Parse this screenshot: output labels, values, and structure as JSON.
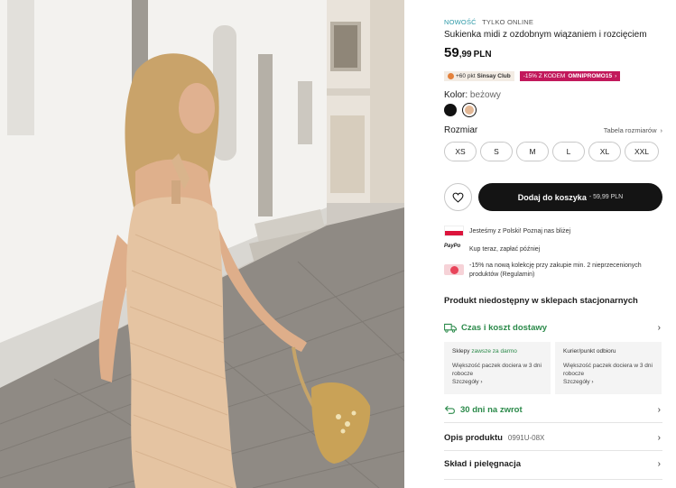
{
  "product": {
    "tag_new": "NOWOŚĆ",
    "tag_online": "TYLKO ONLINE",
    "title": "Sukienka midi z ozdobnym wiązaniem i rozcięciem",
    "price_main": "59",
    "price_cents": ",99",
    "currency": "PLN"
  },
  "promo": {
    "club_text": "+60 pkt",
    "club_name": "Sinsay Club",
    "code_text": "-15% Z KODEM",
    "code_name": "OMNIPROMO15",
    "code_arrow": "›"
  },
  "color": {
    "label": "Kolor:",
    "value": "beżowy",
    "swatches": [
      {
        "name": "black",
        "hex": "#111111"
      },
      {
        "name": "beige",
        "hex": "#e3b896",
        "selected": true
      }
    ]
  },
  "size": {
    "label": "Rozmiar",
    "table_link": "Tabela rozmiarów",
    "table_arrow": "›",
    "options": [
      "XS",
      "S",
      "M",
      "L",
      "XL",
      "XXL"
    ]
  },
  "cart": {
    "label": "Dodaj do koszyka",
    "sub": "- 59,99 PLN"
  },
  "info": {
    "poland": "Jesteśmy z Polski! Poznaj nas bliżej",
    "paypo_logo": "PayPo",
    "paypo": "Kup teraz, zapłać później",
    "discount": "-15% na nową kolekcję przy zakupie min. 2 nieprzecenionych produktów (Regulamin)"
  },
  "availability": {
    "unavailable": "Produkt niedostępny w sklepach stacjonarnych"
  },
  "delivery": {
    "label": "Czas i koszt dostawy",
    "chevron": "›",
    "stores_head": "Sklepy",
    "stores_free": "zawsze za darmo",
    "stores_text": "Większość paczek dociera w 3 dni robocze",
    "stores_details": "Szczegóły ›",
    "courier_head": "Kurier/punkt odbioru",
    "courier_text": "Większość paczek dociera w 3 dni robocze",
    "courier_details": "Szczegóły ›"
  },
  "returns": {
    "label": "30 dni na zwrot",
    "chevron": "›"
  },
  "description": {
    "label": "Opis produktu",
    "code": "0991U-08X",
    "chevron": "›"
  },
  "care": {
    "label": "Skład i pielęgnacja",
    "chevron": "›"
  },
  "colors": {
    "accent_green": "#2b8a4a",
    "accent_teal": "#2e9aa8",
    "promo_pink": "#c2185b",
    "button_dark": "#141414"
  }
}
